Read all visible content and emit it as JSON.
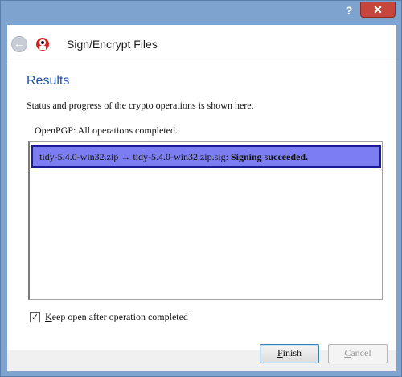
{
  "titlebar": {
    "help_label": "?",
    "close_label": "✕"
  },
  "wizard": {
    "title": "Sign/Encrypt Files",
    "back_icon": "back-arrow-icon",
    "app_icon": "kleopatra-icon"
  },
  "page": {
    "heading": "Results",
    "description": "Status and progress of the crypto operations is shown here.",
    "status": "OpenPGP: All operations completed."
  },
  "results": [
    {
      "text": "tidy-5.4.0-win32.zip → tidy-5.4.0-win32.zip.sig: ",
      "result": "Signing succeeded."
    }
  ],
  "options": {
    "keep_open_checked": true,
    "keep_open_accel": "K",
    "keep_open_rest": "eep open after operation completed"
  },
  "buttons": {
    "finish_accel": "F",
    "finish_rest": "inish",
    "cancel_accel": "C",
    "cancel_rest": "ancel"
  },
  "colors": {
    "selection_fill": "#7b7df0",
    "selection_border": "#1b1b9a",
    "heading_blue": "#1f4fa8",
    "close_red": "#c7463b"
  }
}
